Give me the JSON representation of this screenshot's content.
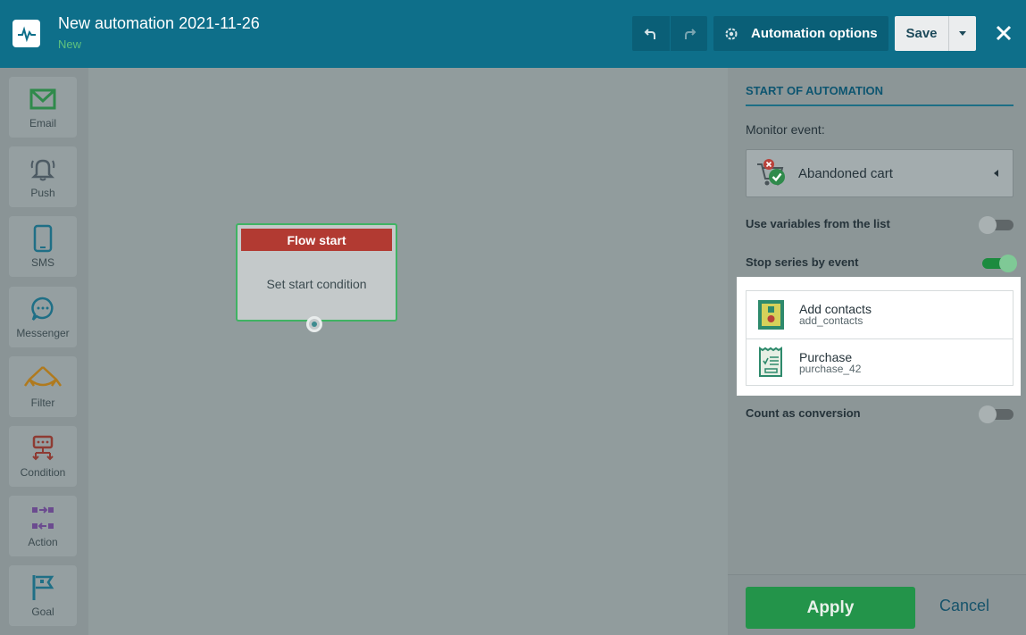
{
  "header": {
    "title": "New automation 2021-11-26",
    "status": "New",
    "options_label": "Automation options",
    "save_label": "Save"
  },
  "toolbox": {
    "items": [
      {
        "label": "Email",
        "icon": "envelope-icon"
      },
      {
        "label": "Push",
        "icon": "bell-icon"
      },
      {
        "label": "SMS",
        "icon": "phone-icon"
      },
      {
        "label": "Messenger",
        "icon": "chat-icon"
      },
      {
        "label": "Filter",
        "icon": "filter-icon"
      },
      {
        "label": "Condition",
        "icon": "condition-icon"
      },
      {
        "label": "Action",
        "icon": "action-icon"
      },
      {
        "label": "Goal",
        "icon": "flag-icon"
      }
    ]
  },
  "canvas": {
    "node": {
      "title": "Flow start",
      "body": "Set start condition"
    }
  },
  "panel": {
    "title": "START OF AUTOMATION",
    "monitor_label": "Monitor event:",
    "event_value": "Abandoned cart",
    "use_variables_label": "Use variables from the list",
    "use_variables_on": false,
    "stop_series_label": "Stop series by event",
    "stop_series_on": true,
    "events": [
      {
        "name": "Add contacts",
        "code": "add_contacts"
      },
      {
        "name": "Purchase",
        "code": "purchase_42"
      }
    ],
    "count_conversion_label": "Count as conversion",
    "count_conversion_on": false,
    "apply_label": "Apply",
    "cancel_label": "Cancel"
  },
  "colors": {
    "header_bg": "#0e6f8a",
    "accent_green": "#23944a",
    "node_header": "#b23a32",
    "status_green": "#5fc27e"
  }
}
